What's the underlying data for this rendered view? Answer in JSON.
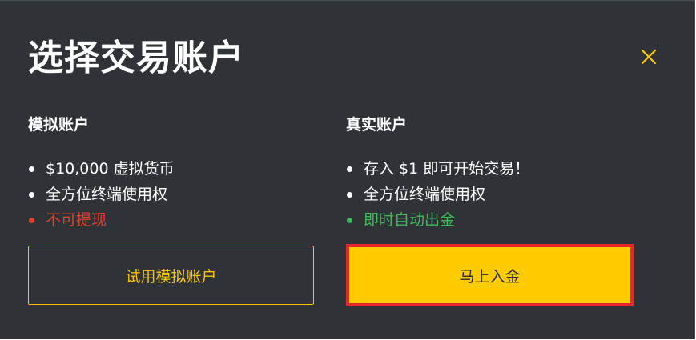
{
  "dialog": {
    "title": "选择交易账户",
    "close_icon": "close-icon",
    "accent_color": "#ffcc00",
    "background_color": "#2f3236"
  },
  "demo_account": {
    "title": "模拟账户",
    "features": [
      {
        "text": "$10,000 虚拟货币",
        "status": "normal"
      },
      {
        "text": "全方位终端使用权",
        "status": "normal"
      },
      {
        "text": "不可提现",
        "status": "negative",
        "color": "#e2412f"
      }
    ],
    "button_label": "试用模拟账户"
  },
  "real_account": {
    "title": "真实账户",
    "features": [
      {
        "text": "存入 $1 即可开始交易！",
        "status": "normal"
      },
      {
        "text": "全方位终端使用权",
        "status": "normal"
      },
      {
        "text": "即时自动出金",
        "status": "positive",
        "color": "#3dbb5a"
      }
    ],
    "button_label": "马上入金",
    "highlight_color": "#e8262b"
  }
}
